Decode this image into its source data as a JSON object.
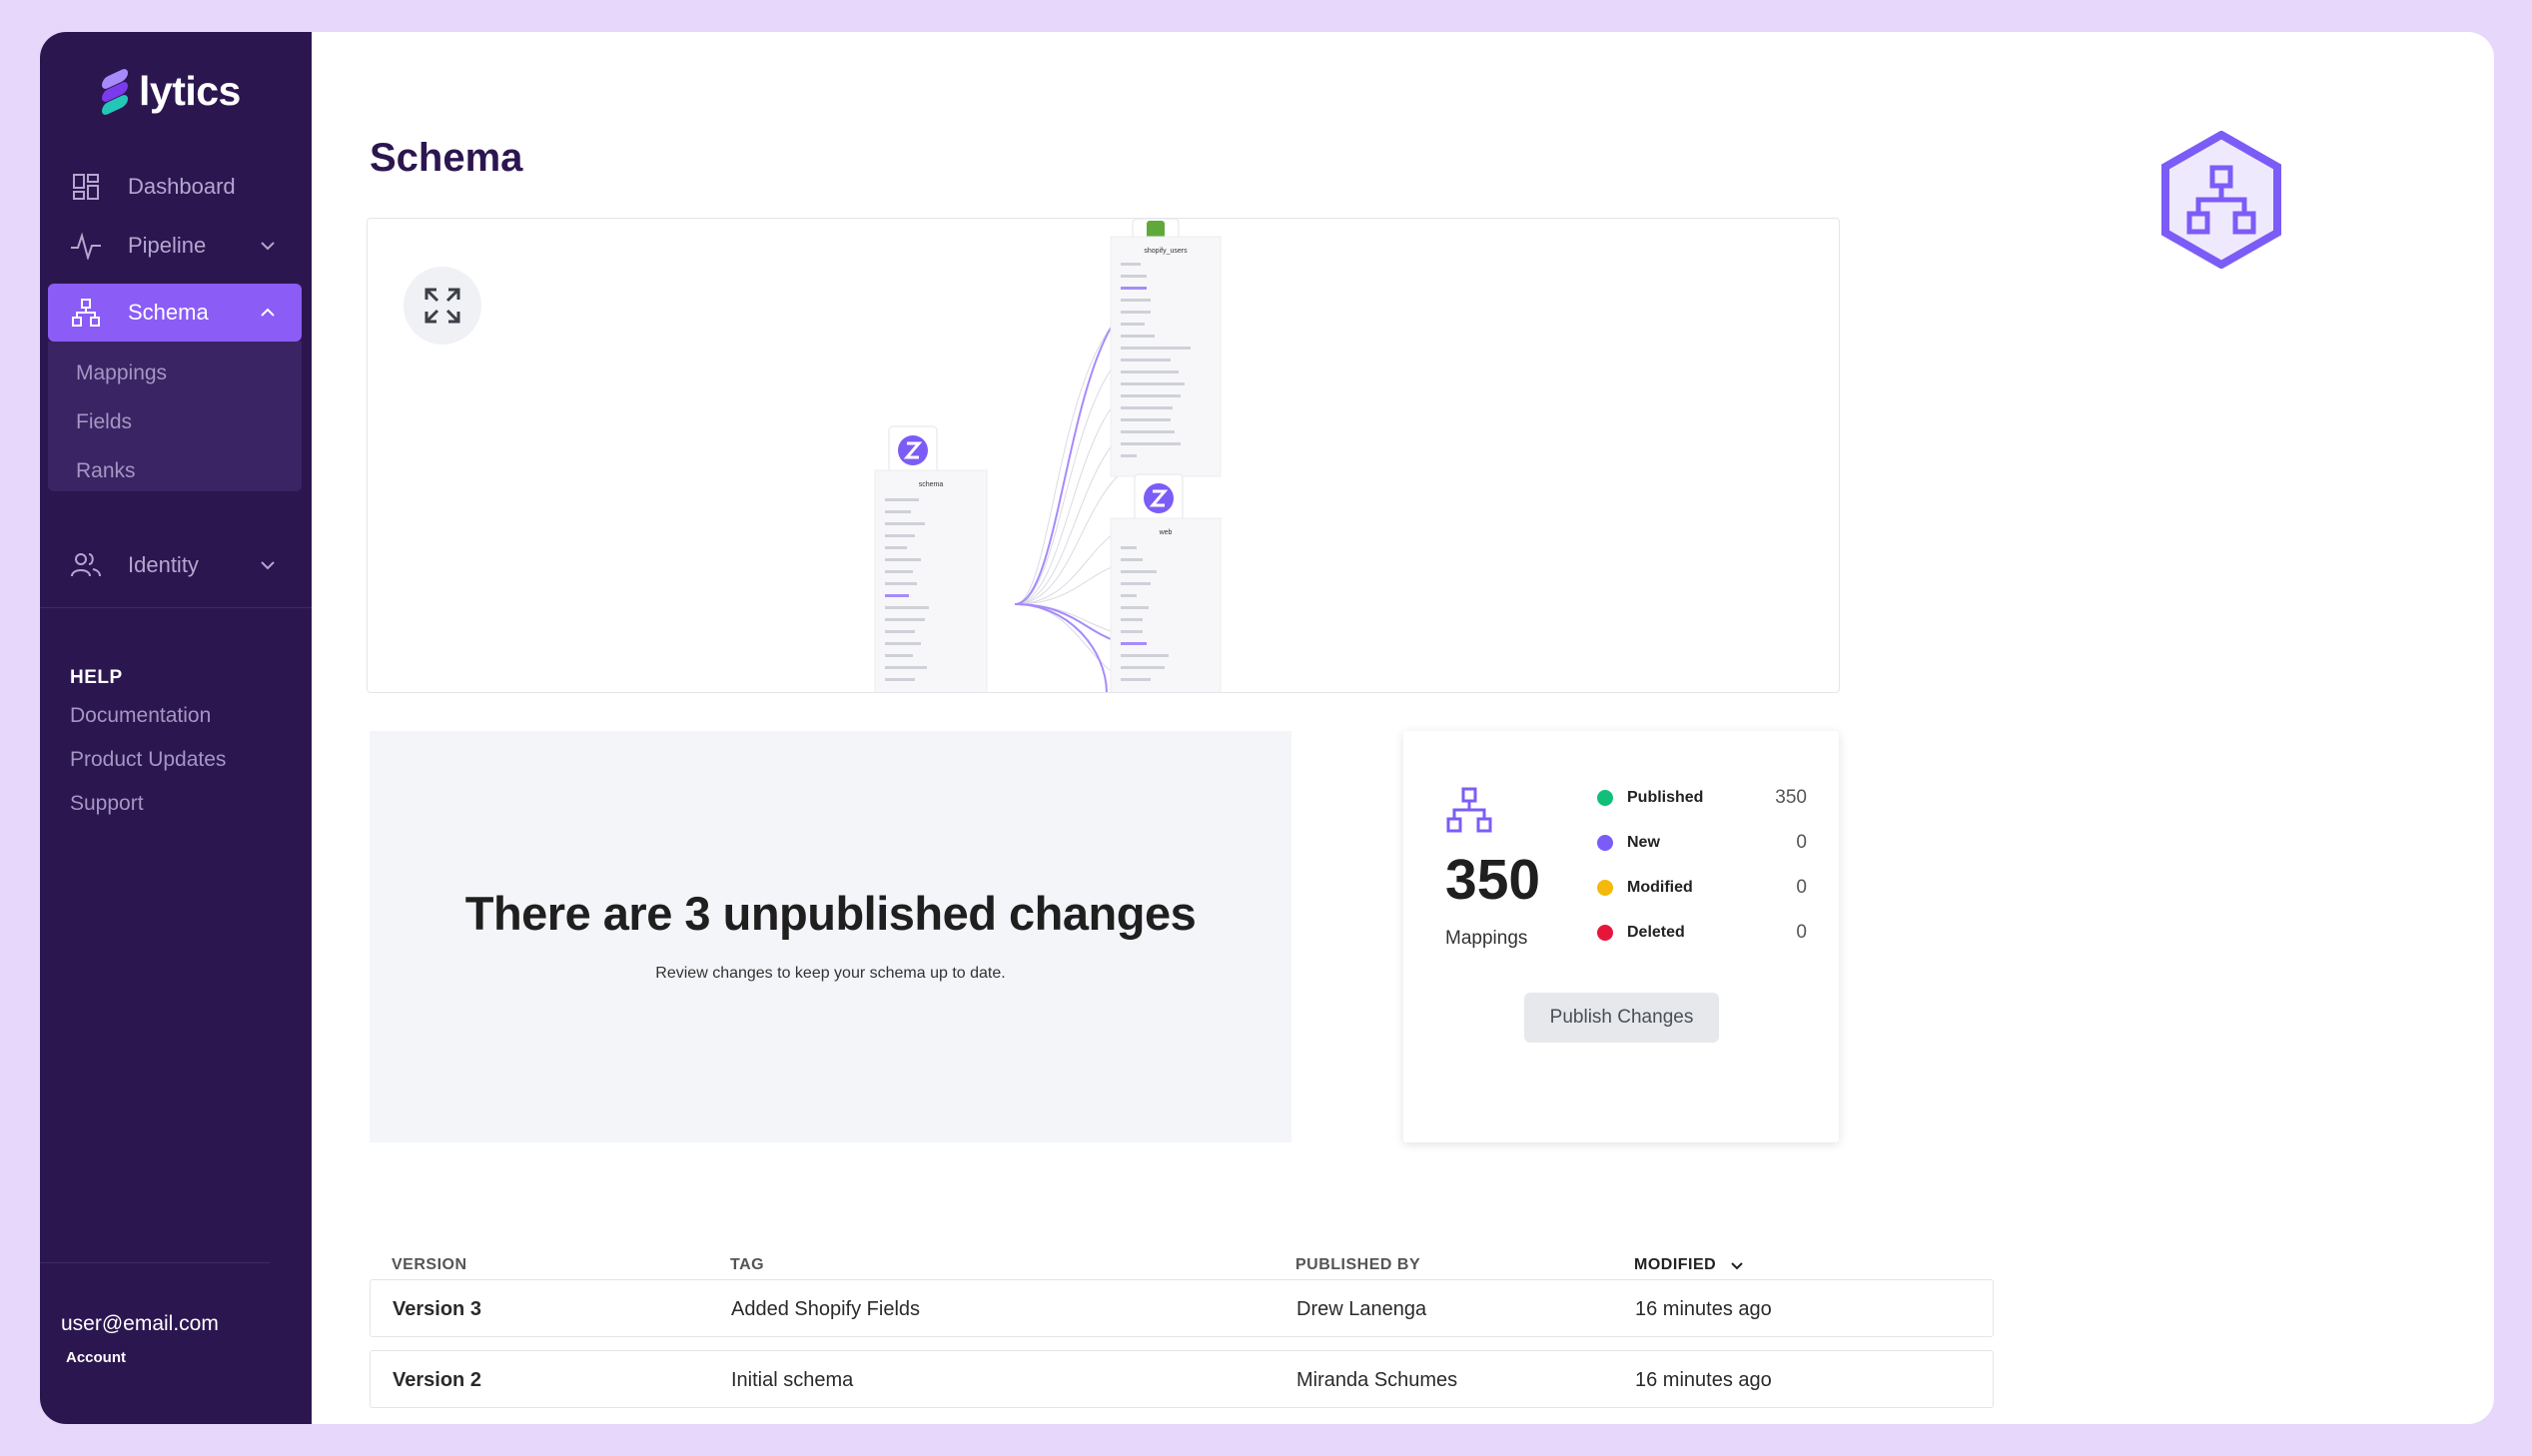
{
  "brand": {
    "name": "lytics"
  },
  "sidebar": {
    "nav": [
      {
        "label": "Dashboard",
        "icon": "dashboard-icon"
      },
      {
        "label": "Pipeline",
        "icon": "pipeline-icon"
      },
      {
        "label": "Schema",
        "icon": "schema-icon"
      },
      {
        "label": "Identity",
        "icon": "identity-icon"
      }
    ],
    "schema_sub": [
      "Mappings",
      "Fields",
      "Ranks"
    ],
    "help": {
      "title": "HELP",
      "links": [
        "Documentation",
        "Product Updates",
        "Support"
      ]
    },
    "user": {
      "email": "user@email.com",
      "account_label": "Account"
    }
  },
  "page": {
    "title": "Schema"
  },
  "diagram": {
    "top_node_label": "shopify_users",
    "left_node_label": "schema",
    "right_node_label": "web"
  },
  "notice": {
    "title": "There are 3 unpublished changes",
    "subtitle": "Review changes to keep your schema up to date."
  },
  "stats": {
    "total": "350",
    "total_label": "Mappings",
    "rows": [
      {
        "name": "Published",
        "value": "350",
        "color": "#10c07a"
      },
      {
        "name": "New",
        "value": "0",
        "color": "#7c5cf6"
      },
      {
        "name": "Modified",
        "value": "0",
        "color": "#f5b90a"
      },
      {
        "name": "Deleted",
        "value": "0",
        "color": "#e8153a"
      }
    ],
    "publish_label": "Publish Changes"
  },
  "table": {
    "headers": [
      "VERSION",
      "TAG",
      "PUBLISHED BY",
      "MODIFIED"
    ],
    "rows": [
      {
        "version": "Version 3",
        "tag": "Added Shopify Fields",
        "by": "Drew Lanenga",
        "modified": "16 minutes ago"
      },
      {
        "version": "Version 2",
        "tag": "Initial schema",
        "by": "Miranda Schumes",
        "modified": "16 minutes ago"
      }
    ]
  },
  "colors": {
    "sidebar_bg": "#2c1650",
    "accent": "#8b5cf6",
    "frame_bg": "#e6d7fb"
  }
}
